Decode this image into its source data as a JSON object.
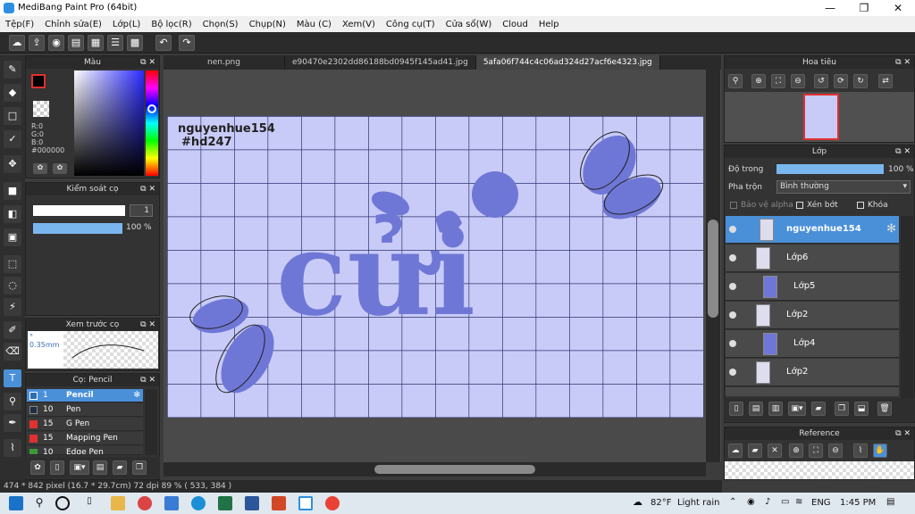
{
  "app": {
    "title": "MediBang Paint Pro (64bit)"
  },
  "window_controls": {
    "minimize": "—",
    "maximize": "❐",
    "close": "✕"
  },
  "menu": [
    "Tệp(F)",
    "Chỉnh sửa(E)",
    "Lớp(L)",
    "Bộ lọc(R)",
    "Chọn(S)",
    "Chụp(N)",
    "Màu (C)",
    "Xem(V)",
    "Công cụ(T)",
    "Cửa sổ(W)",
    "Cloud",
    "Help"
  ],
  "tabs": [
    "nen.png",
    "e90470e2302dd86188bd0945f145ad41.jpg",
    "5afa06f744c4c06ad324d27acf6e4323.jpg"
  ],
  "color_panel": {
    "title": "Màu",
    "r": "R:0",
    "g": "G:0",
    "b": "B:0",
    "hex": "#000000"
  },
  "brush_control": {
    "title": "Kiểm soát cọ",
    "size": "1",
    "opacity": "100 %"
  },
  "brush_preview": {
    "title": "Xem trước cọ",
    "size": "0.35mm"
  },
  "brush_list": {
    "title": "Cọ: Pencil",
    "items": [
      {
        "size": "1",
        "name": "Pencil",
        "color": "#2a6fb0"
      },
      {
        "size": "10",
        "name": "Pen",
        "color": "#1f2f44"
      },
      {
        "size": "15",
        "name": "G Pen",
        "color": "#e03030"
      },
      {
        "size": "15",
        "name": "Mapping Pen",
        "color": "#e03030"
      },
      {
        "size": "10",
        "name": "Edge Pen",
        "color": "#3a9a3a"
      }
    ]
  },
  "canvas": {
    "text1": "nguyenhue154",
    "text2": "#hd247",
    "word": "cửi",
    "bg": "#c8cbf7",
    "accent": "#6f77d6"
  },
  "navigator": {
    "title": "Hoa tiêu"
  },
  "layer_panel": {
    "title": "Lớp",
    "opacity_label": "Độ trong",
    "opacity_value": "100 %",
    "blend_label": "Pha trộn",
    "blend_value": "Bình thường",
    "protect_alpha": "Bảo vệ alpha",
    "clipping": "Xén bớt",
    "lock": "Khóa",
    "layers": [
      {
        "name": "nguyenhue154",
        "selected": true
      },
      {
        "name": "Lớp6",
        "selected": false
      },
      {
        "name": "Lớp5",
        "selected": false
      },
      {
        "name": "Lớp2",
        "selected": false
      },
      {
        "name": "Lớp4",
        "selected": false
      },
      {
        "name": "Lớp2",
        "selected": false
      }
    ]
  },
  "reference": {
    "title": "Reference"
  },
  "status": {
    "text": "474 * 842 pixel   (16.7 * 29.7cm)   72 dpi   89 %   ( 533, 384 )"
  },
  "taskbar": {
    "weather_temp": "82°F",
    "weather_text": "Light rain",
    "lang": "ENG",
    "time": "1:45 PM"
  }
}
